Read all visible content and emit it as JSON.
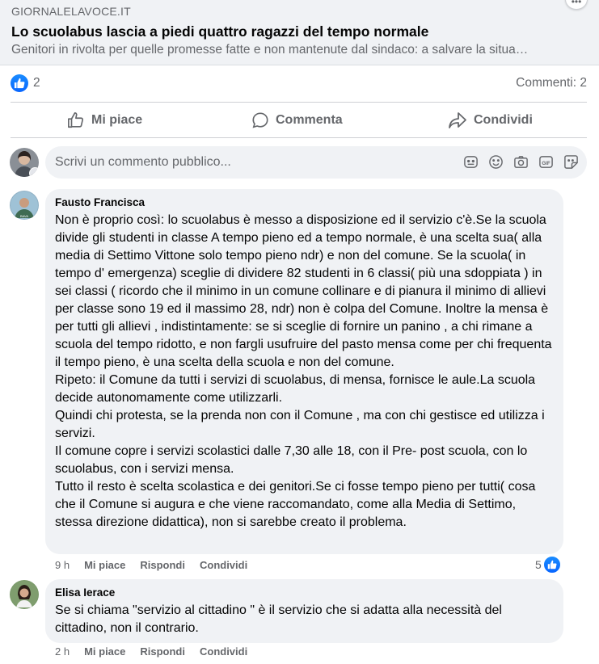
{
  "preview": {
    "source": "GIORNALELAVOCE.IT",
    "title": "Lo scuolabus lascia a piedi quattro ragazzi del tempo normale",
    "description": "Genitori in rivolta per quelle promesse fatte e non mantenute dal sindaco: a salvare la situa…"
  },
  "stats": {
    "like_count": "2",
    "comments": "Commenti: 2"
  },
  "actions": {
    "like": "Mi piace",
    "comment": "Commenta",
    "share": "Condividi"
  },
  "composer": {
    "placeholder": "Scrivi un commento pubblico..."
  },
  "comments": [
    {
      "author": "Fausto Francisca",
      "paragraphs": [
        "Non è proprio così: lo scuolabus è messo a disposizione ed il servizio c'è.Se la scuola divide gli studenti in classe A tempo pieno ed a tempo normale, è una scelta sua( alla media di Settimo Vittone solo tempo pieno ndr) e non del comune. Se la scuola( in tempo d' emergenza) sceglie di dividere 82 studenti in 6 classi( più una sdoppiata ) in sei classi ( ricordo che il minimo in un comune collinare e di pianura il minimo di allievi per classe sono 19 ed il massimo 28, ndr) non è colpa del Comune. Inoltre la mensa è per tutti gli allievi , indistintamente: se si sceglie di fornire un panino , a chi rimane a scuola del tempo ridotto, e non fargli usufruire del pasto mensa come per chi frequenta il tempo pieno, è una scelta della scuola e non del comune.",
        "Ripeto: il Comune da tutti i servizi di scuolabus, di mensa, fornisce le aule.La scuola decide autonomamente come utilizzarli.",
        "Quindi chi protesta, se la prenda non con il Comune , ma con chi gestisce ed utilizza i servizi.",
        "Il comune copre i servizi scolastici dalle 7,30 alle 18, con il Pre- post scuola, con lo scuolabus, con i servizi mensa.",
        "Tutto il resto è scelta scolastica e dei genitori.Se ci fosse tempo pieno per tutti( cosa che il Comune si augura e che viene raccomandato, come alla Media di Settimo, stessa direzione didattica), non si sarebbe creato il problema."
      ],
      "time": "9 h",
      "like": "Mi piace",
      "reply": "Rispondi",
      "share": "Condividi",
      "reactions": "5"
    },
    {
      "author": "Elisa Ierace",
      "paragraphs": [
        "Se si chiama \"servizio al cittadino \" è il servizio che si adatta alla necessità del cittadino, non il contrario."
      ],
      "time": "2 h",
      "like": "Mi piace",
      "reply": "Rispondi",
      "share": "Condividi"
    }
  ],
  "icons": {
    "like": "thumbs-up-icon",
    "comment": "speech-bubble-icon",
    "share": "share-arrow-icon",
    "sticker": "sticker-icon",
    "emoji": "smiley-icon",
    "camera": "camera-icon",
    "gif": "gif-icon",
    "avatar_sticker": "avatar-sticker-icon"
  },
  "colors": {
    "brand_blue": "#0866ff",
    "secondary_text": "#65676b",
    "bubble_bg": "#f0f2f5"
  }
}
